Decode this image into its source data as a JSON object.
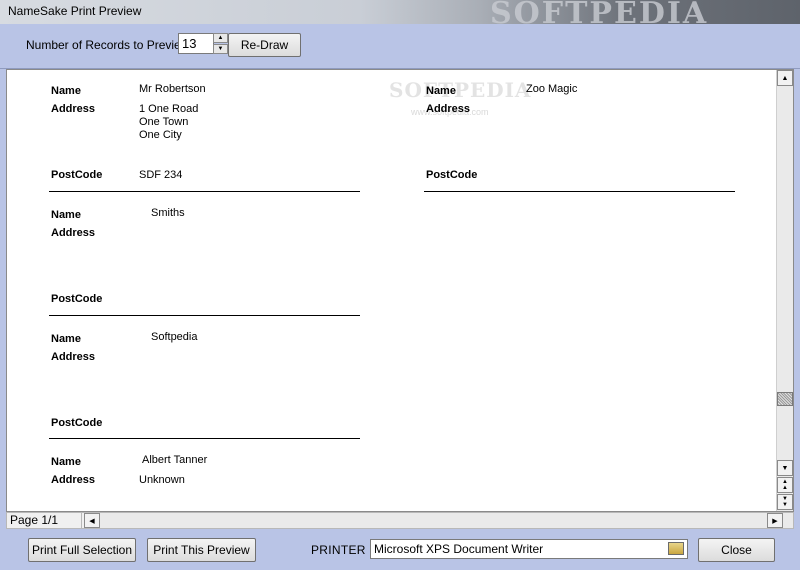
{
  "window": {
    "title": "NameSake Print Preview",
    "watermark": "SOFTPEDIA"
  },
  "toolbar": {
    "records_label": "Number of Records to Preview",
    "records_value": "13",
    "redraw_label": "Re-Draw"
  },
  "preview": {
    "watermark": "SOFTPEDIA",
    "watermark_url": "www.softpedia.com",
    "field_labels": {
      "name": "Name",
      "address": "Address",
      "postcode": "PostCode"
    },
    "records_left": [
      {
        "name": "Mr   Robertson",
        "address_lines": [
          "1 One Road",
          "One Town",
          "One City"
        ],
        "postcode": "SDF 234"
      },
      {
        "name": "Smiths",
        "address_lines": [],
        "postcode": ""
      },
      {
        "name": "Softpedia",
        "address_lines": [],
        "postcode": ""
      },
      {
        "name": "Albert Tanner",
        "address_lines": [
          "Unknown"
        ],
        "postcode": ""
      }
    ],
    "records_right": [
      {
        "name": "Zoo Magic",
        "address_lines": [],
        "postcode": ""
      }
    ]
  },
  "status": {
    "page_indicator": "Page 1/1"
  },
  "bottom": {
    "print_full_label": "Print Full Selection",
    "print_preview_label": "Print This Preview",
    "printer_label": "PRINTER",
    "printer_value": "Microsoft XPS Document Writer",
    "close_label": "Close"
  }
}
